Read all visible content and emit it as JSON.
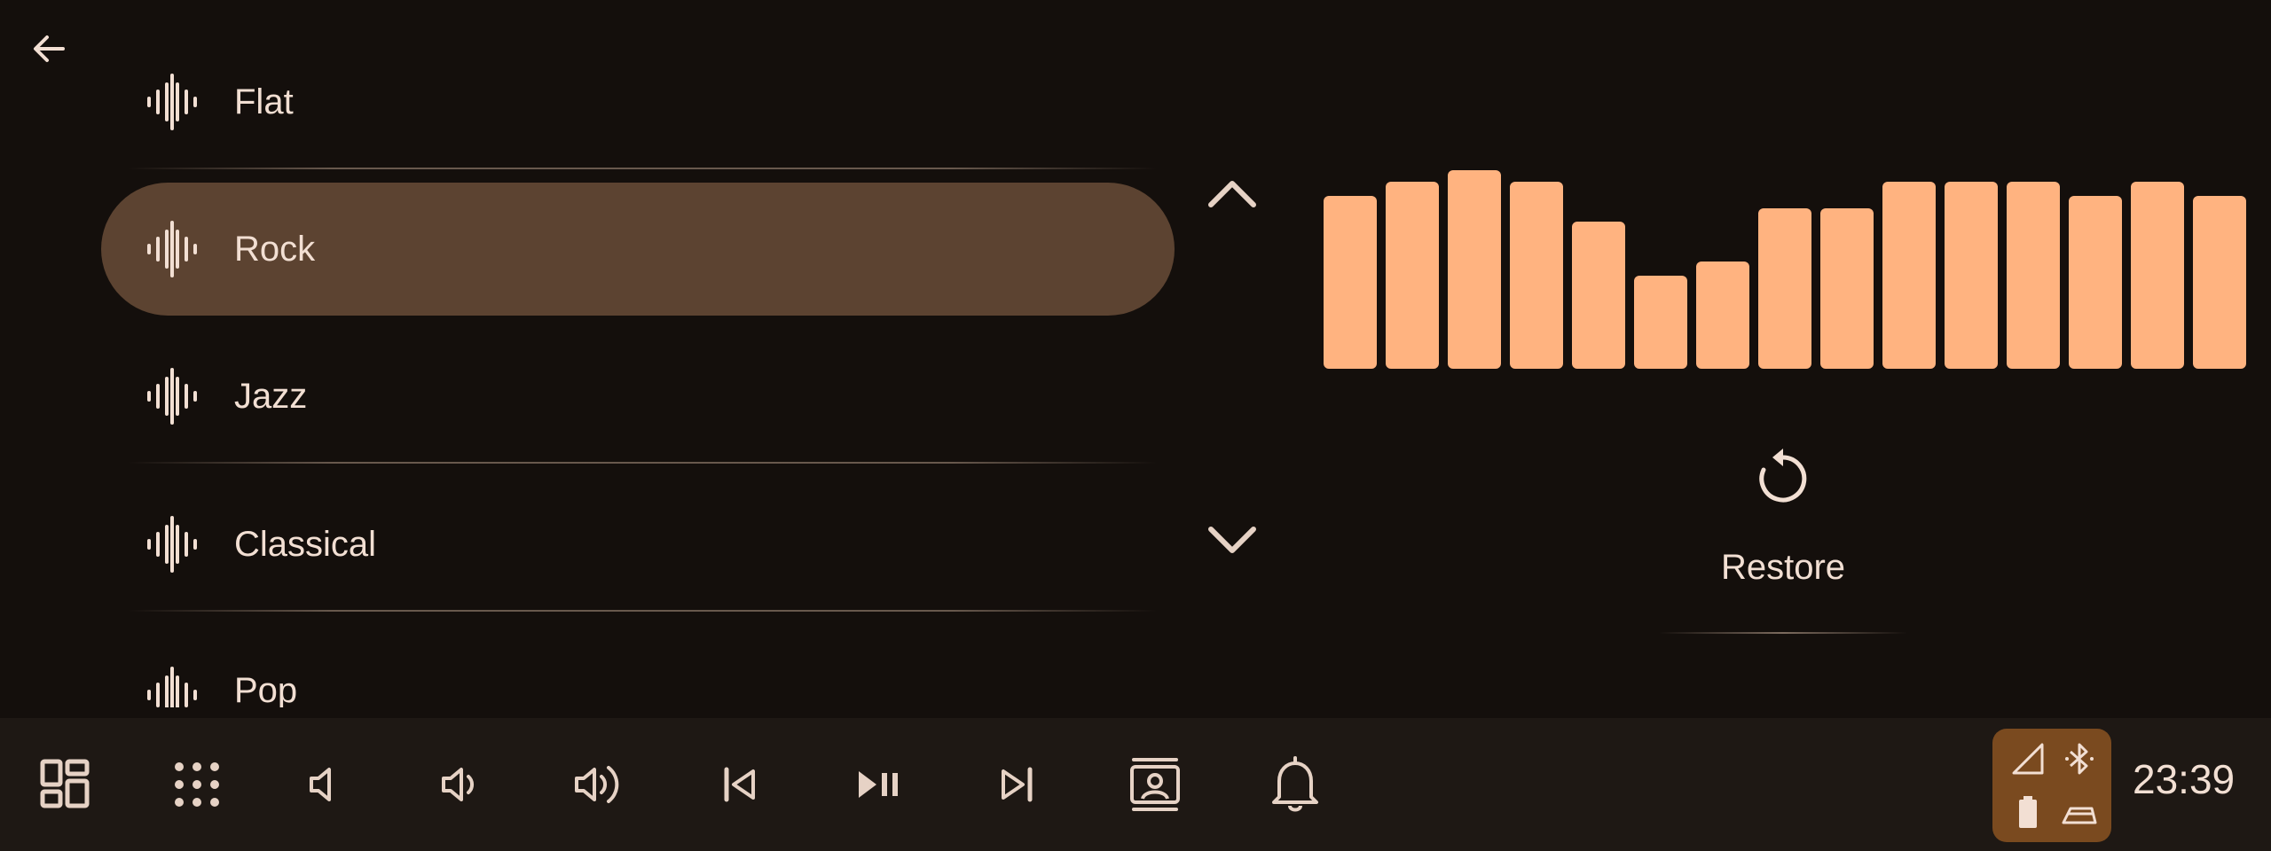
{
  "header": {
    "back_icon": "arrow-left-icon"
  },
  "presets": [
    {
      "label": "Flat",
      "icon": "waveform-icon",
      "selected": false
    },
    {
      "label": "Rock",
      "icon": "waveform-icon",
      "selected": true
    },
    {
      "label": "Jazz",
      "icon": "waveform-icon",
      "selected": false
    },
    {
      "label": "Classical",
      "icon": "waveform-icon",
      "selected": false
    },
    {
      "label": "Pop",
      "icon": "waveform-icon",
      "selected": false
    }
  ],
  "scroll": {
    "up_icon": "chevron-up-icon",
    "down_icon": "chevron-down-icon"
  },
  "equalizer": {
    "levels": [
      0.87,
      0.94,
      1.0,
      0.94,
      0.74,
      0.47,
      0.54,
      0.81,
      0.81,
      0.94,
      0.94,
      0.94,
      0.87,
      0.94,
      0.87
    ],
    "bar_color": "#ffb380"
  },
  "restore": {
    "label": "Restore",
    "icon": "restore-icon"
  },
  "navbar": {
    "buttons": [
      {
        "name": "dashboard-icon"
      },
      {
        "name": "app-grid-icon"
      },
      {
        "name": "volume-mute-icon"
      },
      {
        "name": "volume-down-icon"
      },
      {
        "name": "volume-up-icon"
      },
      {
        "name": "skip-previous-icon"
      },
      {
        "name": "play-pause-icon"
      },
      {
        "name": "skip-next-icon"
      },
      {
        "name": "driver-profile-icon"
      },
      {
        "name": "notification-bell-icon"
      }
    ],
    "status": [
      "signal-icon",
      "bluetooth-icon",
      "battery-icon",
      "car-icon"
    ],
    "status_color": "#7a4a1f",
    "time": "23:39"
  },
  "colors": {
    "background": "#140f0c",
    "selected": "#5c4331",
    "accent": "#ffb380",
    "text": "#f2dfd3"
  }
}
